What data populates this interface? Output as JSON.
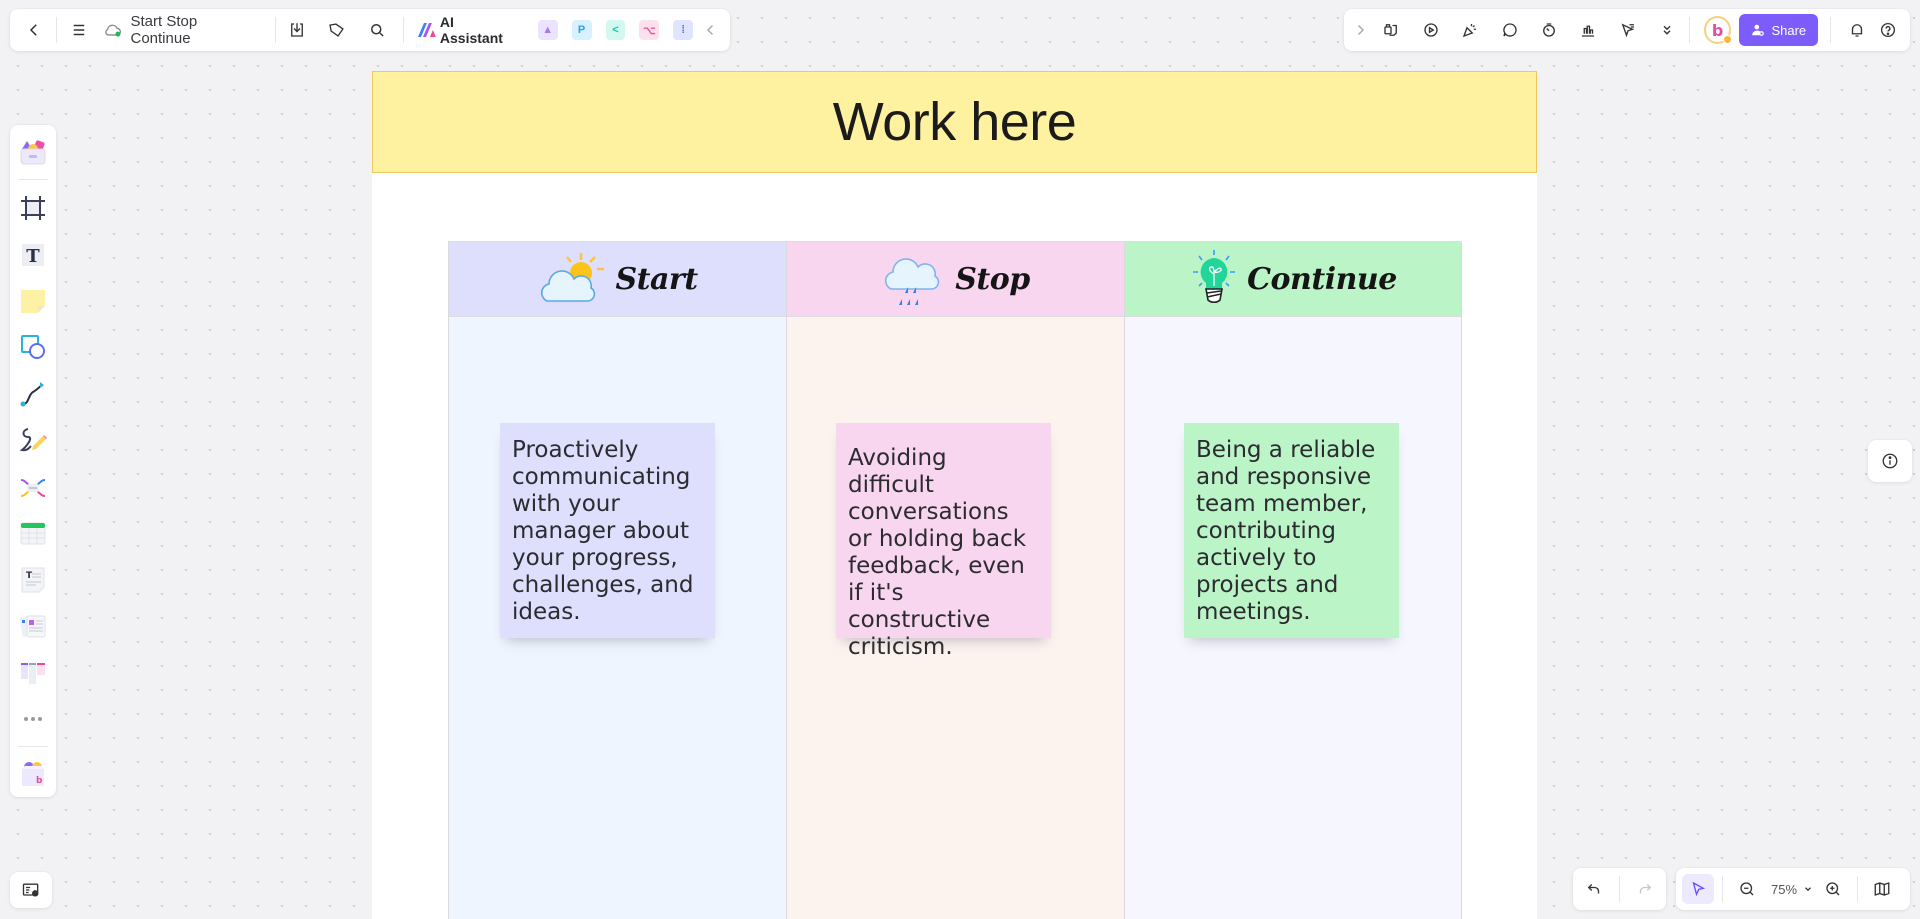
{
  "toolbar_left": {
    "back_label": "Back",
    "menu_label": "Menu",
    "doc_title": "Start Stop Continue",
    "ai_assistant_label": "AI Assistant",
    "apps": [
      {
        "name": "image-generator-icon",
        "glyph": "▲",
        "bg": "#ece3ff",
        "fg": "#a77cf5"
      },
      {
        "name": "presentation-app-icon",
        "glyph": "P",
        "bg": "#d8f1ff",
        "fg": "#2aa2e8"
      },
      {
        "name": "mindmap-app-icon",
        "glyph": "<",
        "bg": "#d2f8f0",
        "fg": "#13c7a6"
      },
      {
        "name": "flowchart-app-icon",
        "glyph": "⌥",
        "bg": "#fde0ee",
        "fg": "#ee4c96"
      },
      {
        "name": "chat-app-icon",
        "glyph": "⁞",
        "bg": "#dfe4ff",
        "fg": "#5b6ef0"
      }
    ]
  },
  "toolbar_right": {
    "share_label": "Share",
    "avatar_letter": "b"
  },
  "banner": {
    "title": "Work here"
  },
  "columns": [
    {
      "title": "Start",
      "icon": "sun-cloud-icon",
      "head_bg": "#dedffd",
      "body_bg": "#eef5fe",
      "note": {
        "text": "Proactively communicating with your manager about your progress, challenges, and ideas.",
        "bg": "#dedffd"
      }
    },
    {
      "title": "Stop",
      "icon": "rain-cloud-icon",
      "head_bg": "#f8d6ef",
      "body_bg": "#fcf3ee",
      "note": {
        "text": "Avoiding difficult conversations or holding back feedback, even if it's constructive criticism.",
        "bg": "#f8d6ef"
      }
    },
    {
      "title": "Continue",
      "icon": "lightbulb-icon",
      "head_bg": "#bbf5c7",
      "body_bg": "#f5f6fe",
      "note": {
        "text": "Being a reliable and responsive team member, contributing actively to projects and meetings.",
        "bg": "#bbf5c7"
      }
    }
  ],
  "zoom": {
    "value": "75%"
  },
  "colors": {
    "accent": "#7c5cfa",
    "banner_bg": "#fef1a0",
    "banner_border": "#efc95e"
  }
}
